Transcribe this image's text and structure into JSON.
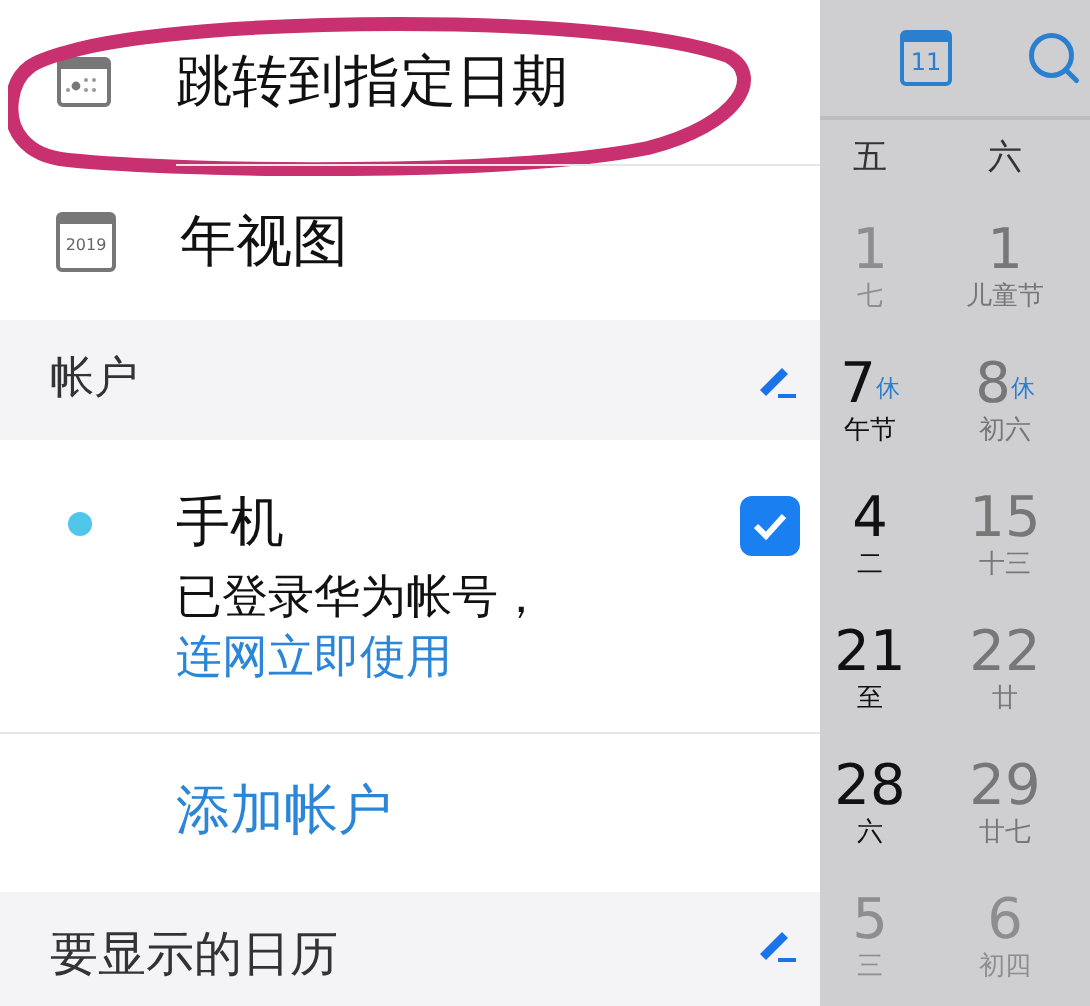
{
  "drawer": {
    "menu_items": [
      {
        "kind": "jump",
        "label": "跳转到指定日期",
        "circled": true
      },
      {
        "kind": "year",
        "label": "年视图",
        "icon_text": "2019"
      }
    ],
    "accounts_section": {
      "title": "帐户",
      "accounts": [
        {
          "name": "手机",
          "color": "#4fc6ea",
          "checked": true,
          "note": "已登录华为帐号，",
          "link": "连网立即使用"
        }
      ],
      "add_label": "添加帐户"
    },
    "calendars_section": {
      "title": "要显示的日历"
    }
  },
  "calendar": {
    "today_icon_text": "11",
    "weekdays": [
      "五",
      "六"
    ],
    "rows": [
      [
        {
          "day": "1",
          "lunar": "七",
          "muted": true
        },
        {
          "day": "1",
          "lunar": "儿童节",
          "muted": false
        }
      ],
      [
        {
          "day": "7",
          "lunar": "午节",
          "muted": false,
          "badge": "休"
        },
        {
          "day": "8",
          "lunar": "初六",
          "muted": false,
          "badge": "休"
        }
      ],
      [
        {
          "day": "4",
          "lunar": "二",
          "muted": false
        },
        {
          "day": "15",
          "lunar": "十三",
          "muted": false
        }
      ],
      [
        {
          "day": "21",
          "lunar": "至",
          "muted": false
        },
        {
          "day": "22",
          "lunar": "廿",
          "muted": false
        }
      ],
      [
        {
          "day": "28",
          "lunar": "六",
          "muted": false
        },
        {
          "day": "29",
          "lunar": "廿七",
          "muted": false
        }
      ],
      [
        {
          "day": "5",
          "lunar": "三",
          "muted": true
        },
        {
          "day": "6",
          "lunar": "初四",
          "muted": true
        }
      ]
    ]
  }
}
